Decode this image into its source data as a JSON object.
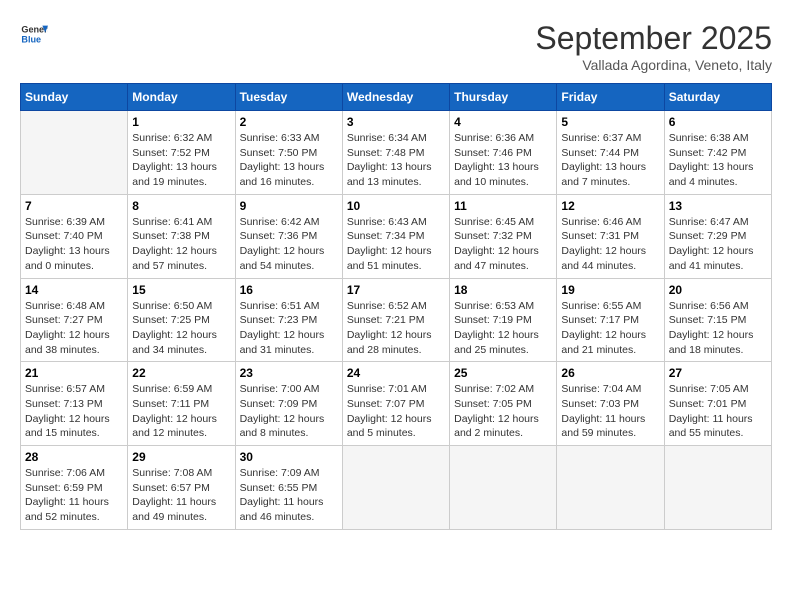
{
  "header": {
    "logo_line1": "General",
    "logo_line2": "Blue",
    "month_title": "September 2025",
    "location": "Vallada Agordina, Veneto, Italy"
  },
  "days_of_week": [
    "Sunday",
    "Monday",
    "Tuesday",
    "Wednesday",
    "Thursday",
    "Friday",
    "Saturday"
  ],
  "weeks": [
    [
      {
        "date": "",
        "detail": ""
      },
      {
        "date": "1",
        "detail": "Sunrise: 6:32 AM\nSunset: 7:52 PM\nDaylight: 13 hours\nand 19 minutes."
      },
      {
        "date": "2",
        "detail": "Sunrise: 6:33 AM\nSunset: 7:50 PM\nDaylight: 13 hours\nand 16 minutes."
      },
      {
        "date": "3",
        "detail": "Sunrise: 6:34 AM\nSunset: 7:48 PM\nDaylight: 13 hours\nand 13 minutes."
      },
      {
        "date": "4",
        "detail": "Sunrise: 6:36 AM\nSunset: 7:46 PM\nDaylight: 13 hours\nand 10 minutes."
      },
      {
        "date": "5",
        "detail": "Sunrise: 6:37 AM\nSunset: 7:44 PM\nDaylight: 13 hours\nand 7 minutes."
      },
      {
        "date": "6",
        "detail": "Sunrise: 6:38 AM\nSunset: 7:42 PM\nDaylight: 13 hours\nand 4 minutes."
      }
    ],
    [
      {
        "date": "7",
        "detail": "Sunrise: 6:39 AM\nSunset: 7:40 PM\nDaylight: 13 hours\nand 0 minutes."
      },
      {
        "date": "8",
        "detail": "Sunrise: 6:41 AM\nSunset: 7:38 PM\nDaylight: 12 hours\nand 57 minutes."
      },
      {
        "date": "9",
        "detail": "Sunrise: 6:42 AM\nSunset: 7:36 PM\nDaylight: 12 hours\nand 54 minutes."
      },
      {
        "date": "10",
        "detail": "Sunrise: 6:43 AM\nSunset: 7:34 PM\nDaylight: 12 hours\nand 51 minutes."
      },
      {
        "date": "11",
        "detail": "Sunrise: 6:45 AM\nSunset: 7:32 PM\nDaylight: 12 hours\nand 47 minutes."
      },
      {
        "date": "12",
        "detail": "Sunrise: 6:46 AM\nSunset: 7:31 PM\nDaylight: 12 hours\nand 44 minutes."
      },
      {
        "date": "13",
        "detail": "Sunrise: 6:47 AM\nSunset: 7:29 PM\nDaylight: 12 hours\nand 41 minutes."
      }
    ],
    [
      {
        "date": "14",
        "detail": "Sunrise: 6:48 AM\nSunset: 7:27 PM\nDaylight: 12 hours\nand 38 minutes."
      },
      {
        "date": "15",
        "detail": "Sunrise: 6:50 AM\nSunset: 7:25 PM\nDaylight: 12 hours\nand 34 minutes."
      },
      {
        "date": "16",
        "detail": "Sunrise: 6:51 AM\nSunset: 7:23 PM\nDaylight: 12 hours\nand 31 minutes."
      },
      {
        "date": "17",
        "detail": "Sunrise: 6:52 AM\nSunset: 7:21 PM\nDaylight: 12 hours\nand 28 minutes."
      },
      {
        "date": "18",
        "detail": "Sunrise: 6:53 AM\nSunset: 7:19 PM\nDaylight: 12 hours\nand 25 minutes."
      },
      {
        "date": "19",
        "detail": "Sunrise: 6:55 AM\nSunset: 7:17 PM\nDaylight: 12 hours\nand 21 minutes."
      },
      {
        "date": "20",
        "detail": "Sunrise: 6:56 AM\nSunset: 7:15 PM\nDaylight: 12 hours\nand 18 minutes."
      }
    ],
    [
      {
        "date": "21",
        "detail": "Sunrise: 6:57 AM\nSunset: 7:13 PM\nDaylight: 12 hours\nand 15 minutes."
      },
      {
        "date": "22",
        "detail": "Sunrise: 6:59 AM\nSunset: 7:11 PM\nDaylight: 12 hours\nand 12 minutes."
      },
      {
        "date": "23",
        "detail": "Sunrise: 7:00 AM\nSunset: 7:09 PM\nDaylight: 12 hours\nand 8 minutes."
      },
      {
        "date": "24",
        "detail": "Sunrise: 7:01 AM\nSunset: 7:07 PM\nDaylight: 12 hours\nand 5 minutes."
      },
      {
        "date": "25",
        "detail": "Sunrise: 7:02 AM\nSunset: 7:05 PM\nDaylight: 12 hours\nand 2 minutes."
      },
      {
        "date": "26",
        "detail": "Sunrise: 7:04 AM\nSunset: 7:03 PM\nDaylight: 11 hours\nand 59 minutes."
      },
      {
        "date": "27",
        "detail": "Sunrise: 7:05 AM\nSunset: 7:01 PM\nDaylight: 11 hours\nand 55 minutes."
      }
    ],
    [
      {
        "date": "28",
        "detail": "Sunrise: 7:06 AM\nSunset: 6:59 PM\nDaylight: 11 hours\nand 52 minutes."
      },
      {
        "date": "29",
        "detail": "Sunrise: 7:08 AM\nSunset: 6:57 PM\nDaylight: 11 hours\nand 49 minutes."
      },
      {
        "date": "30",
        "detail": "Sunrise: 7:09 AM\nSunset: 6:55 PM\nDaylight: 11 hours\nand 46 minutes."
      },
      {
        "date": "",
        "detail": ""
      },
      {
        "date": "",
        "detail": ""
      },
      {
        "date": "",
        "detail": ""
      },
      {
        "date": "",
        "detail": ""
      }
    ]
  ]
}
